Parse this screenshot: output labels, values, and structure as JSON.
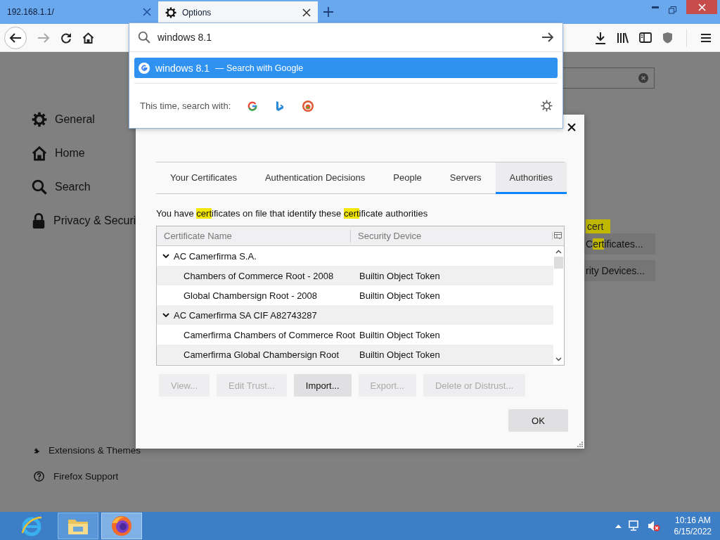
{
  "tabs": [
    {
      "title": "192.168.1.1/",
      "selected": false,
      "icon": false
    },
    {
      "title": "Options",
      "selected": true,
      "icon": true
    }
  ],
  "sidebar": {
    "items": [
      {
        "label": "General",
        "kind": "gear"
      },
      {
        "label": "Home",
        "kind": "home"
      },
      {
        "label": "Search",
        "kind": "search"
      },
      {
        "label": "Privacy & Securi",
        "kind": "lock"
      }
    ],
    "footer": [
      {
        "label": "Extensions & Themes",
        "kind": "puzzle"
      },
      {
        "label": "Firefox Support",
        "kind": "help"
      }
    ]
  },
  "page": {
    "highlight_tag": "cert",
    "buttons": [
      [
        {
          "text": "C",
          "highlight": false
        },
        {
          "text": "ert",
          "highlight": true
        },
        {
          "text": "ificates...",
          "highlight": false
        }
      ],
      [
        {
          "text": "rity Devices...",
          "highlight": false
        }
      ]
    ]
  },
  "search_popup": {
    "value": "windows 8.1",
    "suggestion": {
      "query": "windows 8.1",
      "action": "— Search with Google",
      "selected": true
    },
    "engines_label": "This time, search with:",
    "engines": [
      {
        "kind": "google"
      },
      {
        "kind": "bing"
      },
      {
        "kind": "duckduckgo"
      }
    ]
  },
  "dialog": {
    "tabs": [
      {
        "label": "Your Certificates",
        "selected": false
      },
      {
        "label": "Authentication Decisions",
        "selected": false
      },
      {
        "label": "People",
        "selected": false
      },
      {
        "label": "Servers",
        "selected": false
      },
      {
        "label": "Authorities",
        "selected": true
      }
    ],
    "description": [
      {
        "text": "You have ",
        "highlight": false
      },
      {
        "text": "cert",
        "highlight": true
      },
      {
        "text": "ificates on file that identify these ",
        "highlight": false
      },
      {
        "text": "cert",
        "highlight": true
      },
      {
        "text": "ificate authorities",
        "highlight": false
      }
    ],
    "columns": [
      "Certificate Name",
      "Security Device"
    ],
    "tree": [
      {
        "name": "AC Camerfirma S.A.",
        "expanded": true,
        "children": [
          {
            "name": "Chambers of Commerce Root - 2008",
            "device": "Builtin Object Token"
          },
          {
            "name": "Global Chambersign Root - 2008",
            "device": "Builtin Object Token"
          }
        ]
      },
      {
        "name": "AC Camerfirma SA CIF A82743287",
        "expanded": true,
        "children": [
          {
            "name": "Camerfirma Chambers of Commerce Root",
            "device": "Builtin Object Token"
          },
          {
            "name": "Camerfirma Global Chambersign Root",
            "device": "Builtin Object Token"
          }
        ]
      }
    ],
    "buttons": [
      {
        "label": "View...",
        "disabled": true
      },
      {
        "label": "Edit Trust...",
        "disabled": true
      },
      {
        "label": "Import...",
        "disabled": false
      },
      {
        "label": "Export...",
        "disabled": true
      },
      {
        "label": "Delete or Distrust...",
        "disabled": true
      }
    ],
    "ok": "OK"
  },
  "taskbar": {
    "apps": [
      {
        "kind": "ie",
        "selected": false
      },
      {
        "kind": "explorer",
        "selected": false
      },
      {
        "kind": "firefox",
        "selected": true
      }
    ],
    "time": "10:16 AM",
    "date": "6/15/2022"
  }
}
